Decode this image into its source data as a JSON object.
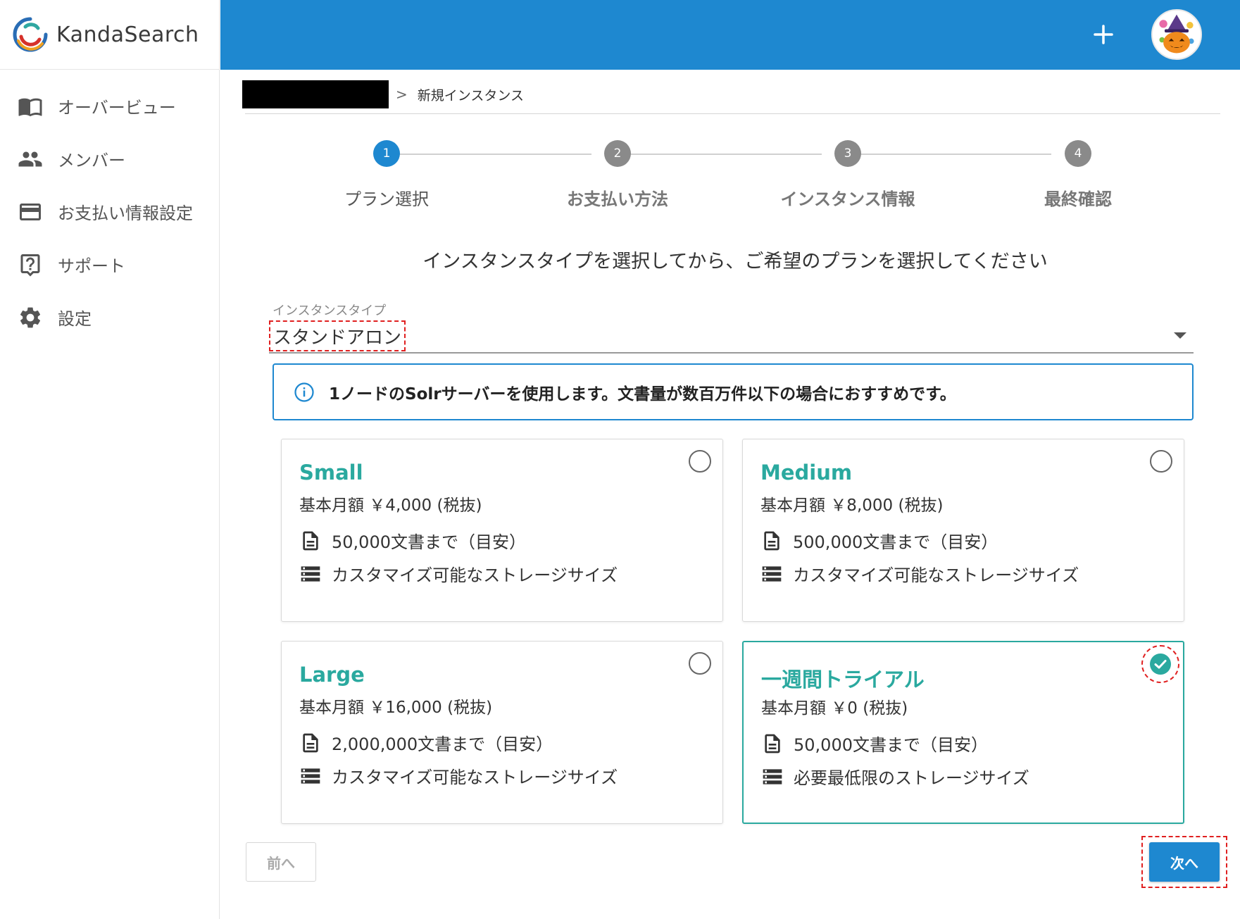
{
  "brand": {
    "name": "KandaSearch"
  },
  "sidebar": {
    "items": [
      {
        "label": "オーバービュー",
        "icon": "book-open-icon"
      },
      {
        "label": "メンバー",
        "icon": "people-icon"
      },
      {
        "label": "お支払い情報設定",
        "icon": "credit-card-icon"
      },
      {
        "label": "サポート",
        "icon": "help-icon"
      },
      {
        "label": "設定",
        "icon": "gear-icon"
      }
    ]
  },
  "topbar": {
    "plus_icon": "plus-icon",
    "avatar_icon": "pumpkin-avatar-icon"
  },
  "breadcrumb": {
    "separator": ">",
    "current": "新規インスタンス"
  },
  "stepper": {
    "steps": [
      {
        "number": "1",
        "label": "プラン選択",
        "state": "active"
      },
      {
        "number": "2",
        "label": "お支払い方法",
        "state": "inactive"
      },
      {
        "number": "3",
        "label": "インスタンス情報",
        "state": "inactive"
      },
      {
        "number": "4",
        "label": "最終確認",
        "state": "inactive"
      }
    ]
  },
  "instruction": "インスタンスタイプを選択してから、ご希望のプランを選択してください",
  "instance_type": {
    "label": "インスタンスタイプ",
    "value": "スタンドアロン"
  },
  "info": {
    "text": "1ノードのSolrサーバーを使用します。文書量が数百万件以下の場合におすすめです。"
  },
  "plans": [
    {
      "title": "Small",
      "price": "基本月額 ￥4,000 (税抜)",
      "docs": "50,000文書まで（目安）",
      "storage": "カスタマイズ可能なストレージサイズ",
      "selected": false
    },
    {
      "title": "Medium",
      "price": "基本月額 ￥8,000 (税抜)",
      "docs": "500,000文書まで（目安）",
      "storage": "カスタマイズ可能なストレージサイズ",
      "selected": false
    },
    {
      "title": "Large",
      "price": "基本月額 ￥16,000 (税抜)",
      "docs": "2,000,000文書まで（目安）",
      "storage": "カスタマイズ可能なストレージサイズ",
      "selected": false
    },
    {
      "title": "一週間トライアル",
      "price": "基本月額 ￥0 (税抜)",
      "docs": "50,000文書まで（目安）",
      "storage": "必要最低限のストレージサイズ",
      "selected": true
    }
  ],
  "buttons": {
    "prev": "前へ",
    "next": "次へ"
  },
  "colors": {
    "primary": "#1e88d0",
    "accent": "#2aa99f",
    "highlight": "#e02020"
  }
}
